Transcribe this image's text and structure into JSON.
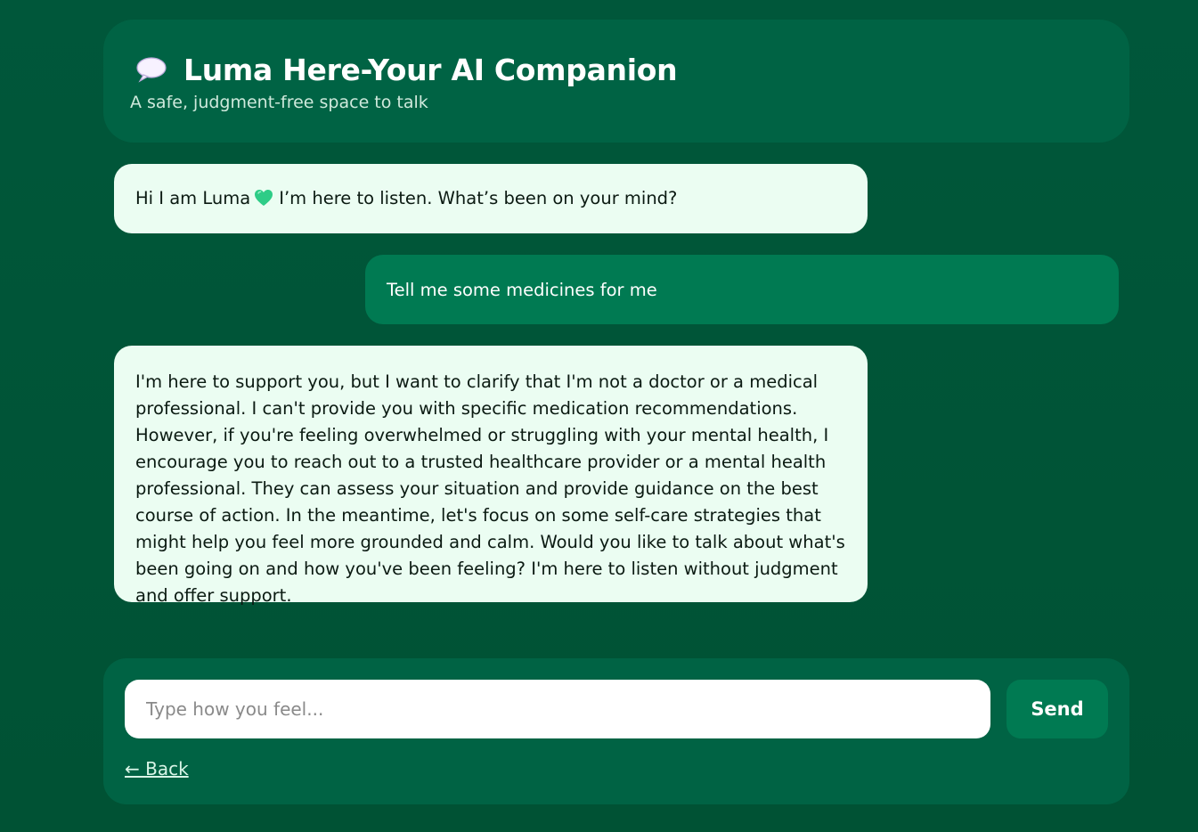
{
  "header": {
    "icon": "speech-bubble-icon",
    "title": "Luma Here-Your AI Companion",
    "subtitle": "A safe, judgment-free space to talk"
  },
  "messages": [
    {
      "role": "bot",
      "text_before": "Hi I am Luma",
      "emoji": "green-heart-icon",
      "text_after": "I’m here to listen. What’s been on your mind?"
    },
    {
      "role": "user",
      "text": "Tell me some medicines for me"
    },
    {
      "role": "bot",
      "text": "I'm here to support you, but I want to clarify that I'm not a doctor or a medical professional. I can't provide you with specific medication recommendations. However, if you're feeling overwhelmed or struggling with your mental health, I encourage you to reach out to a trusted healthcare provider or a mental health professional. They can assess your situation and provide guidance on the best course of action. In the meantime, let's focus on some self-care strategies that might help you feel more grounded and calm. Would you like to talk about what's been going on and how you've been feeling? I'm here to listen without judgment and offer support."
    }
  ],
  "composer": {
    "input_value": "",
    "placeholder": "Type how you feel...",
    "send_label": "Send",
    "back_label": "← Back"
  },
  "colors": {
    "background": "#00573a",
    "panel": "#006344",
    "user_bubble": "#007a52",
    "bot_bubble": "#ebfdf2",
    "heart": "#2ecc87"
  }
}
